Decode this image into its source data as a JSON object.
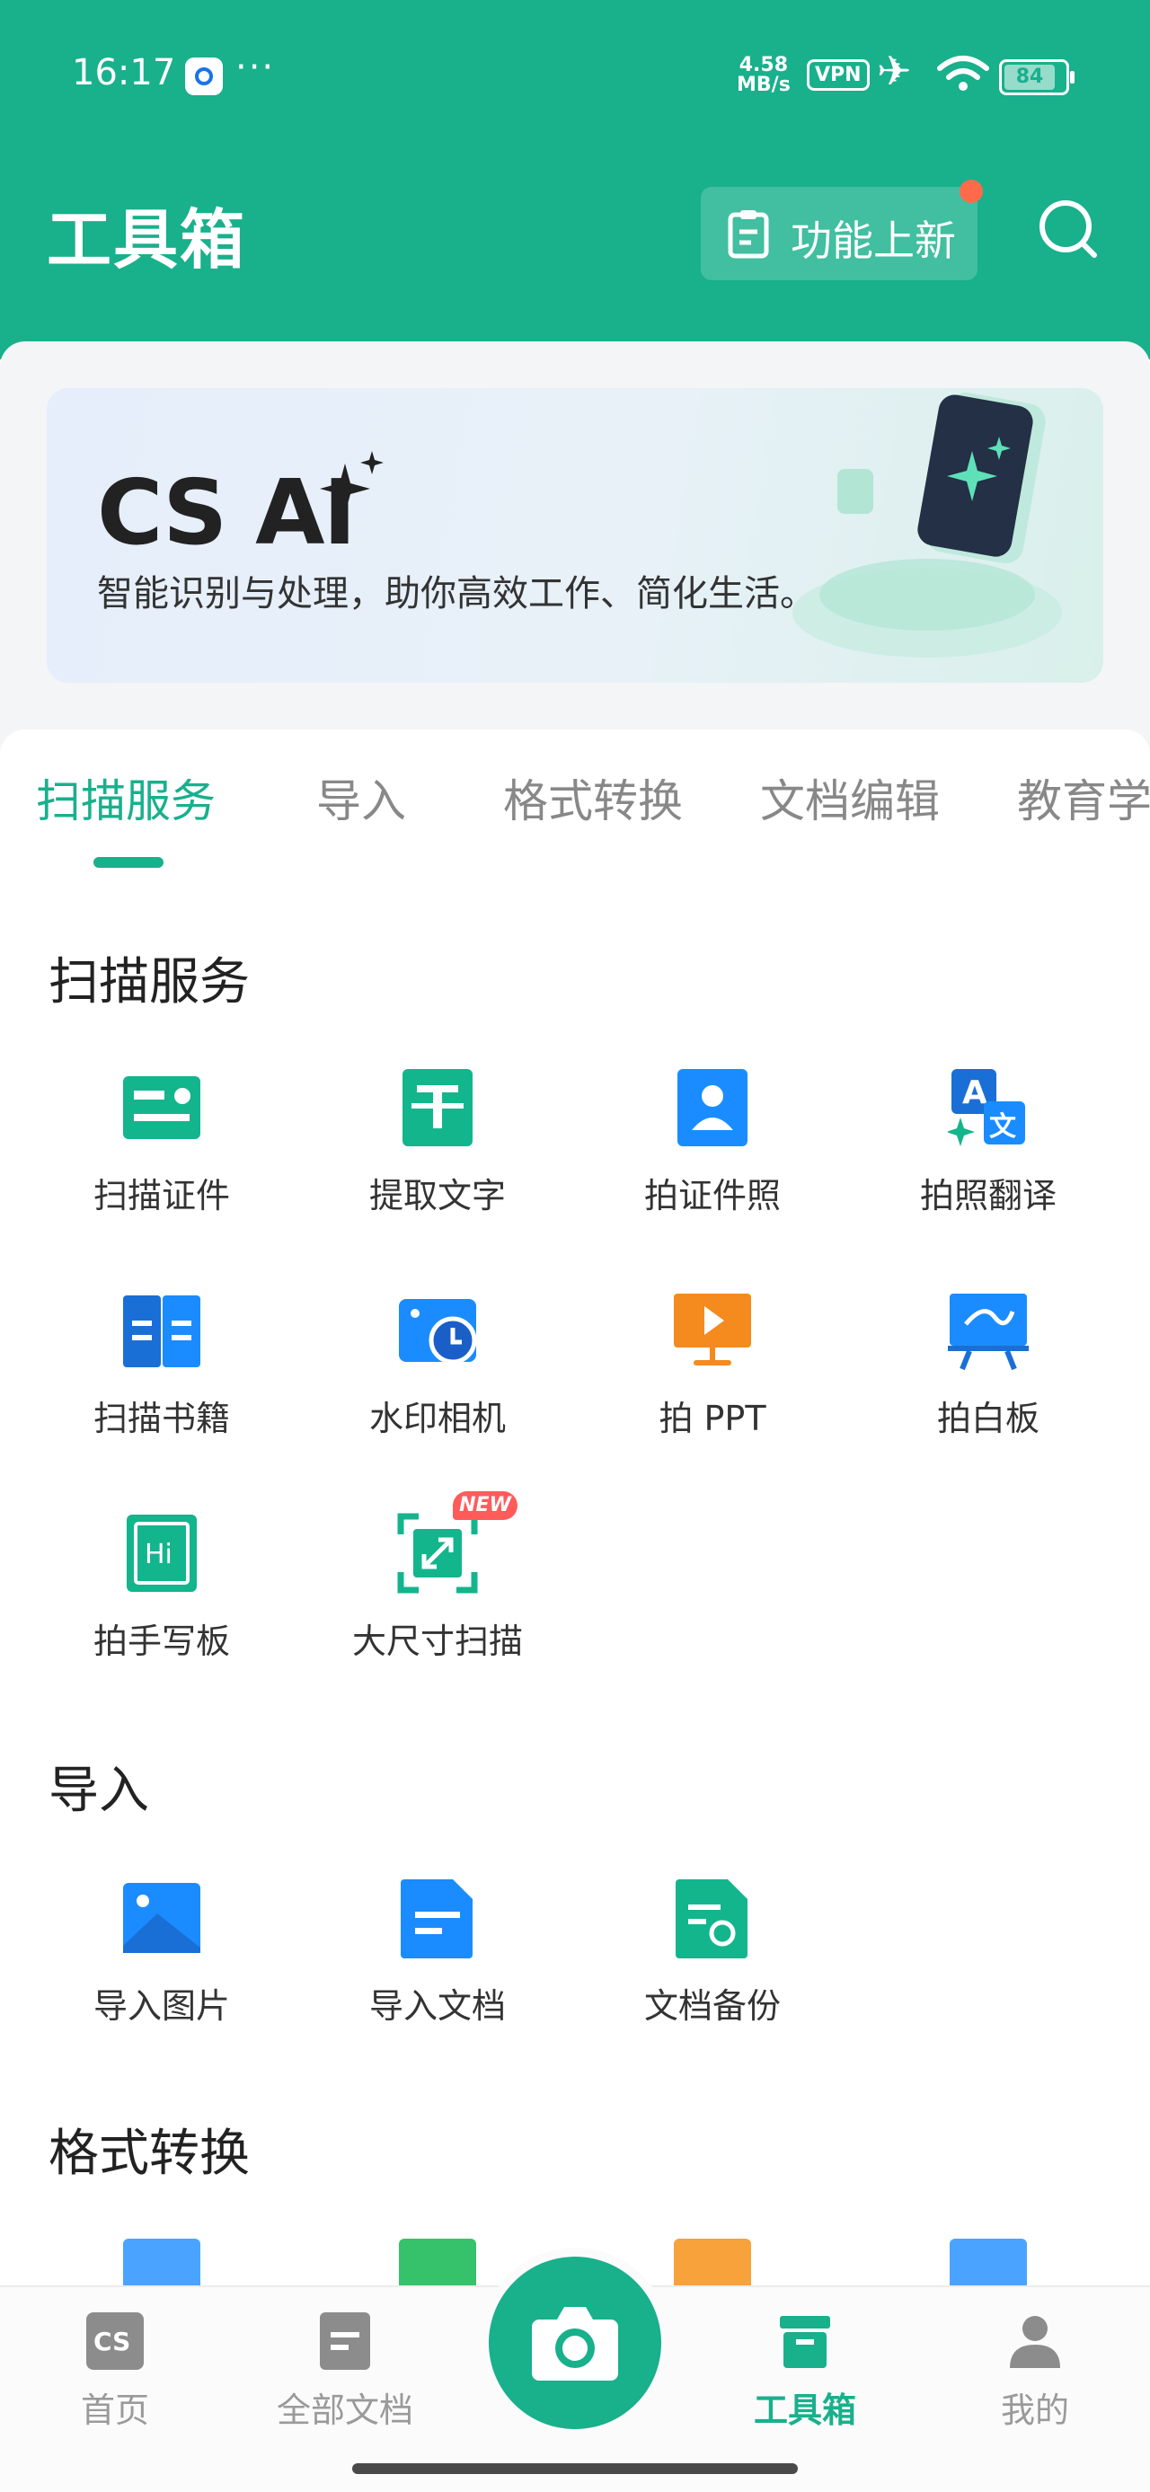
{
  "status_bar": {
    "time": "16:17",
    "dots": "···",
    "speed_top": "4.58",
    "speed_bottom": "MB/s",
    "vpn": "VPN",
    "battery": "84"
  },
  "header": {
    "title": "工具箱",
    "new_features_label": "功能上新"
  },
  "banner": {
    "title": "CS AI",
    "subtitle": "智能识别与处理，助你高效工作、简化生活。"
  },
  "tabs": [
    "扫描服务",
    "导入",
    "格式转换",
    "文档编辑",
    "教育学"
  ],
  "sections": {
    "scan": {
      "title": "扫描服务",
      "items": [
        "扫描证件",
        "提取文字",
        "拍证件照",
        "拍照翻译",
        "扫描书籍",
        "水印相机",
        "拍 PPT",
        "拍白板",
        "拍手写板",
        "大尺寸扫描"
      ],
      "new_badge": "NEW"
    },
    "import": {
      "title": "导入",
      "items": [
        "导入图片",
        "导入文档",
        "文档备份"
      ]
    },
    "convert": {
      "title": "格式转换"
    }
  },
  "bottom_nav": [
    "首页",
    "全部文档",
    "工具箱",
    "我的"
  ],
  "colors": {
    "brand": "#19b08c",
    "badge": "#ff5b5b",
    "dot": "#ff6b4a"
  }
}
